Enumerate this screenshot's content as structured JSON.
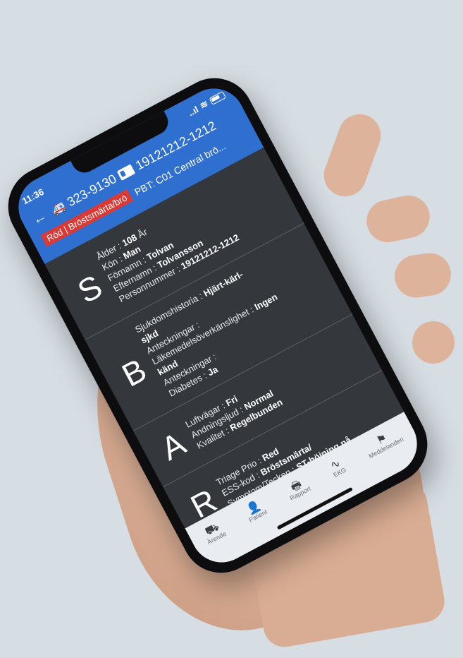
{
  "status": {
    "time": "11:36",
    "signal": "..ıl"
  },
  "header": {
    "ambulance_icon": "ambulance-icon",
    "unit_number": "323-9130",
    "personnummer": "19121212-1212",
    "priority_tag": "Röd | Bröstsmärta/brö",
    "pbt": "PBT: C01 Central brö..."
  },
  "sbar": {
    "s": {
      "letter": "S",
      "lines": [
        {
          "label": "Ålder : ",
          "value": "108",
          "suffix": " År"
        },
        {
          "label": "Kön : ",
          "value": "Man",
          "suffix": ""
        },
        {
          "label": "Förnamn : ",
          "value": "Tolvan",
          "suffix": ""
        },
        {
          "label": "Efternamn : ",
          "value": "Tolvansson",
          "suffix": ""
        },
        {
          "label": "Personnummer : ",
          "value": "19121212-1212",
          "suffix": ""
        }
      ]
    },
    "b": {
      "letter": "B",
      "lines": [
        {
          "label": "Sjukdomshistoria : ",
          "value": "Hjärt-kärl-",
          "suffix": ""
        },
        {
          "label": "",
          "value": "sjkd",
          "suffix": ""
        },
        {
          "label": "Anteckningar :",
          "value": "",
          "suffix": ""
        },
        {
          "label": "Läkemedelsöverkänslighet : ",
          "value": "Ingen",
          "suffix": ""
        },
        {
          "label": "",
          "value": "känd",
          "suffix": ""
        },
        {
          "label": "Anteckningar :",
          "value": "",
          "suffix": ""
        },
        {
          "label": "Diabetes : ",
          "value": "Ja",
          "suffix": ""
        }
      ]
    },
    "a": {
      "letter": "A",
      "lines": [
        {
          "label": "Luftvägar : ",
          "value": "Fri",
          "suffix": ""
        },
        {
          "label": "Andningsljud : ",
          "value": "Normal",
          "suffix": ""
        },
        {
          "label": "Kvalitet : ",
          "value": "Regelbunden",
          "suffix": ""
        }
      ]
    },
    "r": {
      "letter": "R",
      "lines": [
        {
          "label": "Triage Prio : ",
          "value": "Red",
          "suffix": ""
        },
        {
          "label": "ESS-kod : ",
          "value": "Bröstsmärta/",
          "suffix": ""
        },
        {
          "label": "Symptom/Tecken : ",
          "value": "ST-höjning på",
          "suffix": ""
        }
      ]
    }
  },
  "tabs": [
    {
      "label": "Ärende",
      "icon": "ambulance-icon"
    },
    {
      "label": "Patient",
      "icon": "person-icon"
    },
    {
      "label": "Rapport",
      "icon": "printer-icon"
    },
    {
      "label": "EKG",
      "icon": "ecg-icon"
    },
    {
      "label": "Meddelanden",
      "icon": "message-icon"
    }
  ],
  "colors": {
    "header_blue": "#2e6fd0",
    "priority_red": "#d93a35",
    "panel": "#34383d",
    "active_tab": "#f08a24"
  }
}
